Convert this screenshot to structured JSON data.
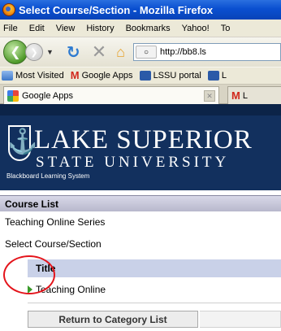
{
  "window": {
    "title": "Select Course/Section - Mozilla Firefox"
  },
  "menu": {
    "items": [
      "File",
      "Edit",
      "View",
      "History",
      "Bookmarks",
      "Yahoo!",
      "To"
    ]
  },
  "nav": {
    "back_icon": "back-arrow-icon",
    "forward_icon": "forward-arrow-icon",
    "url": "http://bb8.ls"
  },
  "bookmarks": {
    "items": [
      "Most Visited",
      "Google Apps",
      "LSSU portal",
      "L"
    ]
  },
  "tabs": {
    "active_label": "Google Apps",
    "inactive_label": "L"
  },
  "banner": {
    "line1": "LAKE SUPERIOR",
    "line2": "STATE UNIVERSITY",
    "tagline": "Blackboard Learning System"
  },
  "page": {
    "section_header": "Course List",
    "breadcrumb_1": "Teaching Online Series",
    "breadcrumb_2": "Select Course/Section",
    "column_title": "Title",
    "courses": [
      {
        "name": "Teaching Online"
      }
    ],
    "return_button": "Return to Category List"
  },
  "colors": {
    "titlebar": "#0a4fd0",
    "banner": "#12305e",
    "annotation": "#e4141b",
    "table_header": "#c9d1e8"
  }
}
